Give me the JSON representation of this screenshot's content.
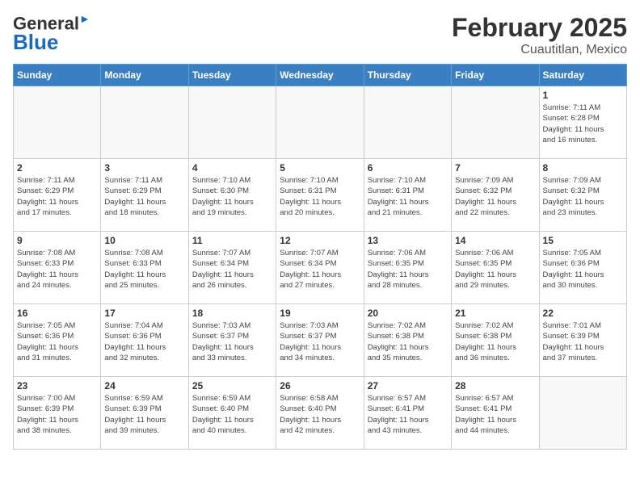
{
  "header": {
    "logo_line1": "General",
    "logo_line2": "Blue",
    "month": "February 2025",
    "location": "Cuautitlan, Mexico"
  },
  "days_of_week": [
    "Sunday",
    "Monday",
    "Tuesday",
    "Wednesday",
    "Thursday",
    "Friday",
    "Saturday"
  ],
  "weeks": [
    [
      {
        "num": "",
        "info": ""
      },
      {
        "num": "",
        "info": ""
      },
      {
        "num": "",
        "info": ""
      },
      {
        "num": "",
        "info": ""
      },
      {
        "num": "",
        "info": ""
      },
      {
        "num": "",
        "info": ""
      },
      {
        "num": "1",
        "info": "Sunrise: 7:11 AM\nSunset: 6:28 PM\nDaylight: 11 hours\nand 16 minutes."
      }
    ],
    [
      {
        "num": "2",
        "info": "Sunrise: 7:11 AM\nSunset: 6:29 PM\nDaylight: 11 hours\nand 17 minutes."
      },
      {
        "num": "3",
        "info": "Sunrise: 7:11 AM\nSunset: 6:29 PM\nDaylight: 11 hours\nand 18 minutes."
      },
      {
        "num": "4",
        "info": "Sunrise: 7:10 AM\nSunset: 6:30 PM\nDaylight: 11 hours\nand 19 minutes."
      },
      {
        "num": "5",
        "info": "Sunrise: 7:10 AM\nSunset: 6:31 PM\nDaylight: 11 hours\nand 20 minutes."
      },
      {
        "num": "6",
        "info": "Sunrise: 7:10 AM\nSunset: 6:31 PM\nDaylight: 11 hours\nand 21 minutes."
      },
      {
        "num": "7",
        "info": "Sunrise: 7:09 AM\nSunset: 6:32 PM\nDaylight: 11 hours\nand 22 minutes."
      },
      {
        "num": "8",
        "info": "Sunrise: 7:09 AM\nSunset: 6:32 PM\nDaylight: 11 hours\nand 23 minutes."
      }
    ],
    [
      {
        "num": "9",
        "info": "Sunrise: 7:08 AM\nSunset: 6:33 PM\nDaylight: 11 hours\nand 24 minutes."
      },
      {
        "num": "10",
        "info": "Sunrise: 7:08 AM\nSunset: 6:33 PM\nDaylight: 11 hours\nand 25 minutes."
      },
      {
        "num": "11",
        "info": "Sunrise: 7:07 AM\nSunset: 6:34 PM\nDaylight: 11 hours\nand 26 minutes."
      },
      {
        "num": "12",
        "info": "Sunrise: 7:07 AM\nSunset: 6:34 PM\nDaylight: 11 hours\nand 27 minutes."
      },
      {
        "num": "13",
        "info": "Sunrise: 7:06 AM\nSunset: 6:35 PM\nDaylight: 11 hours\nand 28 minutes."
      },
      {
        "num": "14",
        "info": "Sunrise: 7:06 AM\nSunset: 6:35 PM\nDaylight: 11 hours\nand 29 minutes."
      },
      {
        "num": "15",
        "info": "Sunrise: 7:05 AM\nSunset: 6:36 PM\nDaylight: 11 hours\nand 30 minutes."
      }
    ],
    [
      {
        "num": "16",
        "info": "Sunrise: 7:05 AM\nSunset: 6:36 PM\nDaylight: 11 hours\nand 31 minutes."
      },
      {
        "num": "17",
        "info": "Sunrise: 7:04 AM\nSunset: 6:36 PM\nDaylight: 11 hours\nand 32 minutes."
      },
      {
        "num": "18",
        "info": "Sunrise: 7:03 AM\nSunset: 6:37 PM\nDaylight: 11 hours\nand 33 minutes."
      },
      {
        "num": "19",
        "info": "Sunrise: 7:03 AM\nSunset: 6:37 PM\nDaylight: 11 hours\nand 34 minutes."
      },
      {
        "num": "20",
        "info": "Sunrise: 7:02 AM\nSunset: 6:38 PM\nDaylight: 11 hours\nand 35 minutes."
      },
      {
        "num": "21",
        "info": "Sunrise: 7:02 AM\nSunset: 6:38 PM\nDaylight: 11 hours\nand 36 minutes."
      },
      {
        "num": "22",
        "info": "Sunrise: 7:01 AM\nSunset: 6:39 PM\nDaylight: 11 hours\nand 37 minutes."
      }
    ],
    [
      {
        "num": "23",
        "info": "Sunrise: 7:00 AM\nSunset: 6:39 PM\nDaylight: 11 hours\nand 38 minutes."
      },
      {
        "num": "24",
        "info": "Sunrise: 6:59 AM\nSunset: 6:39 PM\nDaylight: 11 hours\nand 39 minutes."
      },
      {
        "num": "25",
        "info": "Sunrise: 6:59 AM\nSunset: 6:40 PM\nDaylight: 11 hours\nand 40 minutes."
      },
      {
        "num": "26",
        "info": "Sunrise: 6:58 AM\nSunset: 6:40 PM\nDaylight: 11 hours\nand 42 minutes."
      },
      {
        "num": "27",
        "info": "Sunrise: 6:57 AM\nSunset: 6:41 PM\nDaylight: 11 hours\nand 43 minutes."
      },
      {
        "num": "28",
        "info": "Sunrise: 6:57 AM\nSunset: 6:41 PM\nDaylight: 11 hours\nand 44 minutes."
      },
      {
        "num": "",
        "info": ""
      }
    ]
  ]
}
